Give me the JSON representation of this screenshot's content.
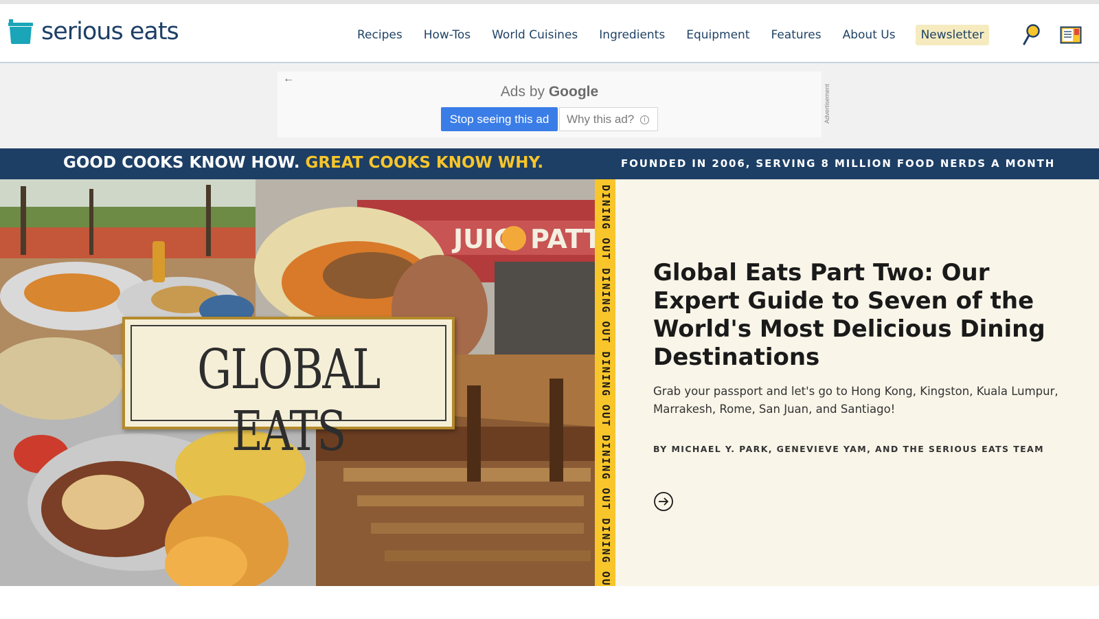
{
  "header": {
    "logo_text": "serious eats",
    "nav": [
      "Recipes",
      "How-Tos",
      "World Cuisines",
      "Ingredients",
      "Equipment",
      "Features",
      "About Us"
    ],
    "newsletter_label": "Newsletter"
  },
  "ad": {
    "title_prefix": "Ads by ",
    "title_brand": "Google",
    "stop_label": "Stop seeing this ad",
    "why_label": "Why this ad?",
    "info_glyph": "i",
    "back_glyph": "←",
    "vertical_label": "Advertisement"
  },
  "banner": {
    "left_white": "GOOD COOKS KNOW HOW.",
    "left_yellow": "GREAT COOKS KNOW WHY.",
    "right": "FOUNDED IN 2006, SERVING 8 MILLION FOOD NERDS A MONTH"
  },
  "hero": {
    "image_title": "GLOBAL EATS",
    "ribbon": "DINING OUT  DINING OUT  DINING OUT  DINING OUT  DINING OUT",
    "title": "Global Eats Part Two: Our Expert Guide to Seven of the World's Most Delicious Dining Destinations",
    "description": "Grab your passport and let's go to Hong Kong, Kingston, Kuala Lumpur, Marrakesh, Rome, San Juan, and Santiago!",
    "byline": "BY MICHAEL Y. PARK, GENEVIEVE YAM, AND THE SERIOUS EATS TEAM"
  },
  "colors": {
    "navy": "#1d3f66",
    "yellow": "#f8c52b",
    "cream": "#f9f5e9",
    "ad_blue": "#3a7de6",
    "logo_teal": "#1aa5b8"
  },
  "icons": [
    "pot-logo-icon",
    "search-icon",
    "card-icon",
    "back-arrow-icon",
    "info-icon",
    "arrow-right-circle-icon"
  ]
}
